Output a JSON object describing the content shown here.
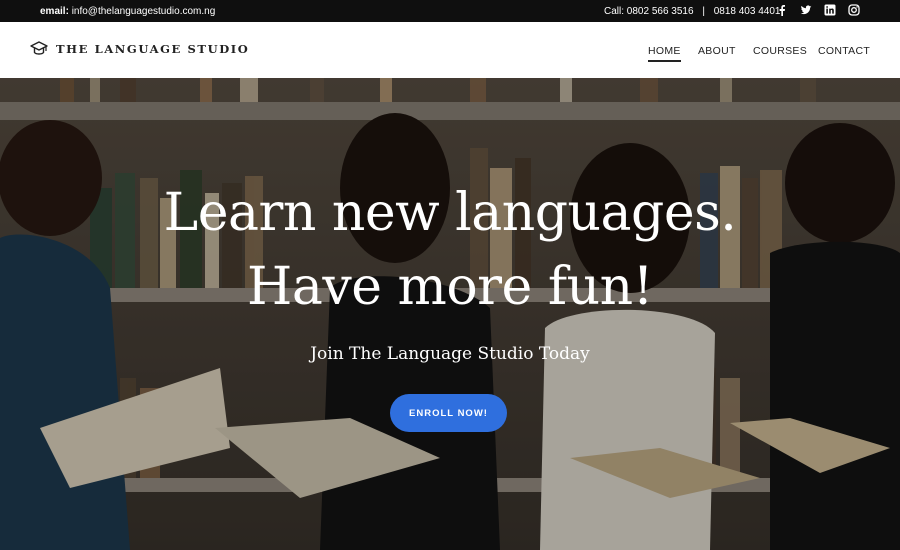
{
  "topbar": {
    "email_label": "email:",
    "email": "info@thelanguagestudio.com.ng",
    "call_label": "Call:",
    "phone1": "0802 566 3516",
    "separator": "|",
    "phone2": "0818 403 4401",
    "social": [
      "facebook-icon",
      "twitter-icon",
      "linkedin-icon",
      "instagram-icon"
    ]
  },
  "header": {
    "brand": "THE LANGUAGE STUDIO",
    "nav": [
      {
        "label": "HOME",
        "active": true
      },
      {
        "label": "ABOUT"
      },
      {
        "label": "COURSES"
      },
      {
        "label": "CONTACT"
      }
    ]
  },
  "hero": {
    "line1": "Learn new languages.",
    "line2": "Have more fun!",
    "subtitle": "Join The Language Studio Today",
    "cta": "ENROLL NOW!"
  },
  "colors": {
    "accent": "#2f6fde",
    "topbar": "#0f0f0f"
  }
}
